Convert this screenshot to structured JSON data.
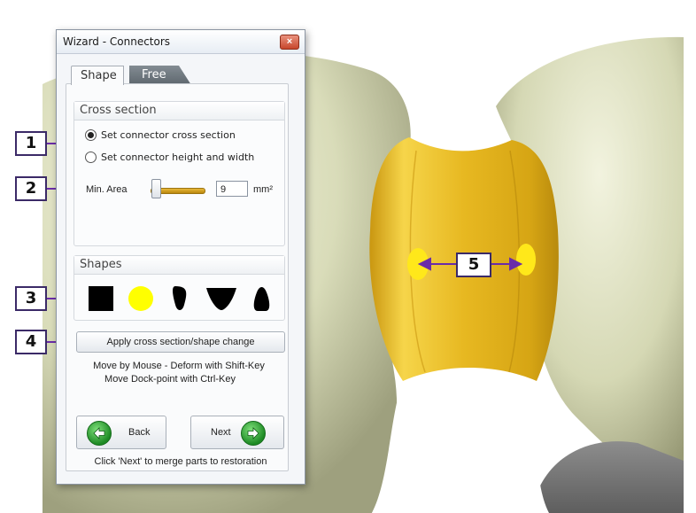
{
  "window": {
    "title": "Wizard - Connectors",
    "close_glyph": "×"
  },
  "tabs": [
    {
      "label": "Shape"
    },
    {
      "label": "Free"
    }
  ],
  "cross_section": {
    "heading": "Cross section",
    "option_1": "Set connector cross section",
    "option_2": "Set connector height and width",
    "selected": "Set connector cross section",
    "min_area_label": "Min. Area",
    "min_area_value": "9",
    "unit": "mm²"
  },
  "shapes": {
    "heading": "Shapes",
    "items": [
      "square-shape",
      "circle-shape",
      "narrow-oval-shape",
      "triangle-shape",
      "bell-shape"
    ],
    "selected_color": "#ffff00"
  },
  "apply_button": "Apply cross section/shape change",
  "hint_1": "Move by Mouse - Deform with Shift-Key",
  "hint_2": "Move Dock-point with Ctrl-Key",
  "back_button": "Back",
  "next_button": "Next",
  "footer_hint": "Click 'Next' to merge parts to restoration",
  "callouts": [
    "1",
    "2",
    "3",
    "4",
    "5"
  ],
  "colors": {
    "accent": "#6a2ca8",
    "connector": "#f2c12c",
    "tooth": "#d8dcb8"
  }
}
